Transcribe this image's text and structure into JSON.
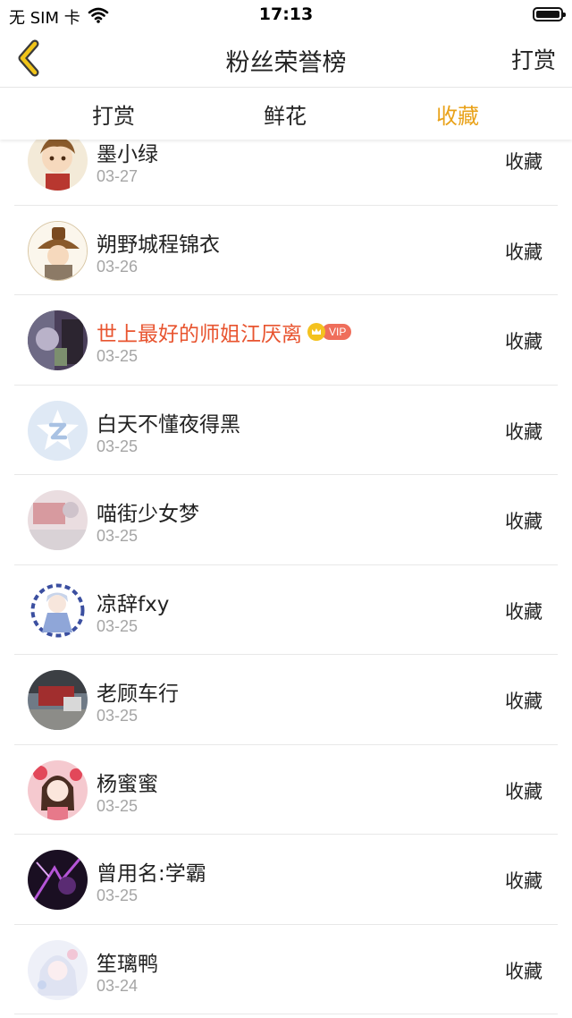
{
  "status_bar": {
    "carrier": "无 SIM 卡",
    "time": "17:13"
  },
  "nav": {
    "title": "粉丝荣誉榜",
    "right_action": "打赏",
    "back_icon": "chevron-left-icon",
    "accent": "#e9a21a"
  },
  "tabs": [
    {
      "label": "打赏",
      "active": false
    },
    {
      "label": "鲜花",
      "active": false
    },
    {
      "label": "收藏",
      "active": true
    }
  ],
  "list": [
    {
      "name": "墨小绿",
      "date": "03-27",
      "action": "收藏",
      "avatar": "cartoon-boy-avatar"
    },
    {
      "name": "朔野城程锦衣",
      "date": "03-26",
      "action": "收藏",
      "avatar": "cartoon-hat-avatar"
    },
    {
      "name": "世上最好的师姐江厌离",
      "date": "03-25",
      "action": "收藏",
      "vip": true,
      "vip_label": "VIP",
      "avatar": "photo-avatar"
    },
    {
      "name": "白天不懂夜得黑",
      "date": "03-25",
      "action": "收藏",
      "avatar": "default-star-avatar"
    },
    {
      "name": "喵街少女梦",
      "date": "03-25",
      "action": "收藏",
      "avatar": "pink-photo-avatar"
    },
    {
      "name": "凉辞fxy",
      "date": "03-25",
      "action": "收藏",
      "avatar": "anime-blue-avatar"
    },
    {
      "name": "老顾车行",
      "date": "03-25",
      "action": "收藏",
      "avatar": "street-photo-avatar"
    },
    {
      "name": "杨蜜蜜",
      "date": "03-25",
      "action": "收藏",
      "avatar": "anime-girl-avatar"
    },
    {
      "name": "曾用名:学霸",
      "date": "03-25",
      "action": "收藏",
      "avatar": "purple-dark-avatar"
    },
    {
      "name": "笙璃鸭",
      "date": "03-24",
      "action": "收藏",
      "avatar": "anime-white-avatar"
    }
  ]
}
